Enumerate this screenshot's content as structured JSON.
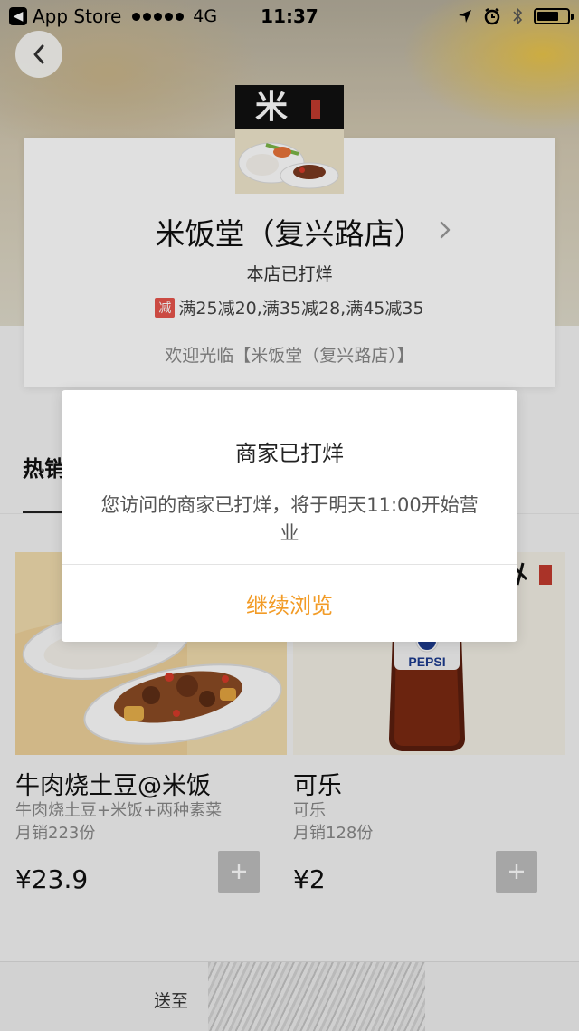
{
  "status_bar": {
    "back_app": "App Store",
    "network": "4G",
    "time": "11:37"
  },
  "shop": {
    "logo_char": "米",
    "name": "米饭堂（复兴路店）",
    "status": "本店已打烊",
    "promo_badge": "减",
    "promo_text": "满25减20,满35减28,满45减35",
    "welcome": "欢迎光临【米饭堂（复兴路店）】"
  },
  "tabs": {
    "hot": "热销"
  },
  "products": [
    {
      "name": "牛肉烧土豆@米饭",
      "description": "牛肉烧土豆+米饭+两种素菜",
      "sales": "月销223份",
      "price": "¥23.9"
    },
    {
      "name": "可乐",
      "description": "可乐",
      "sales": "月销128份",
      "price": "¥2",
      "brand": "PEPSI"
    }
  ],
  "bottom_bar": {
    "delivery_text": "送至"
  },
  "modal": {
    "title": "商家已打烊",
    "message": "您访问的商家已打烊，将于明天11:00开始营业",
    "action": "继续浏览"
  },
  "colors": {
    "accent": "#f29b26",
    "promo_red": "#e8554c",
    "add_button": "#bdbdbd"
  }
}
